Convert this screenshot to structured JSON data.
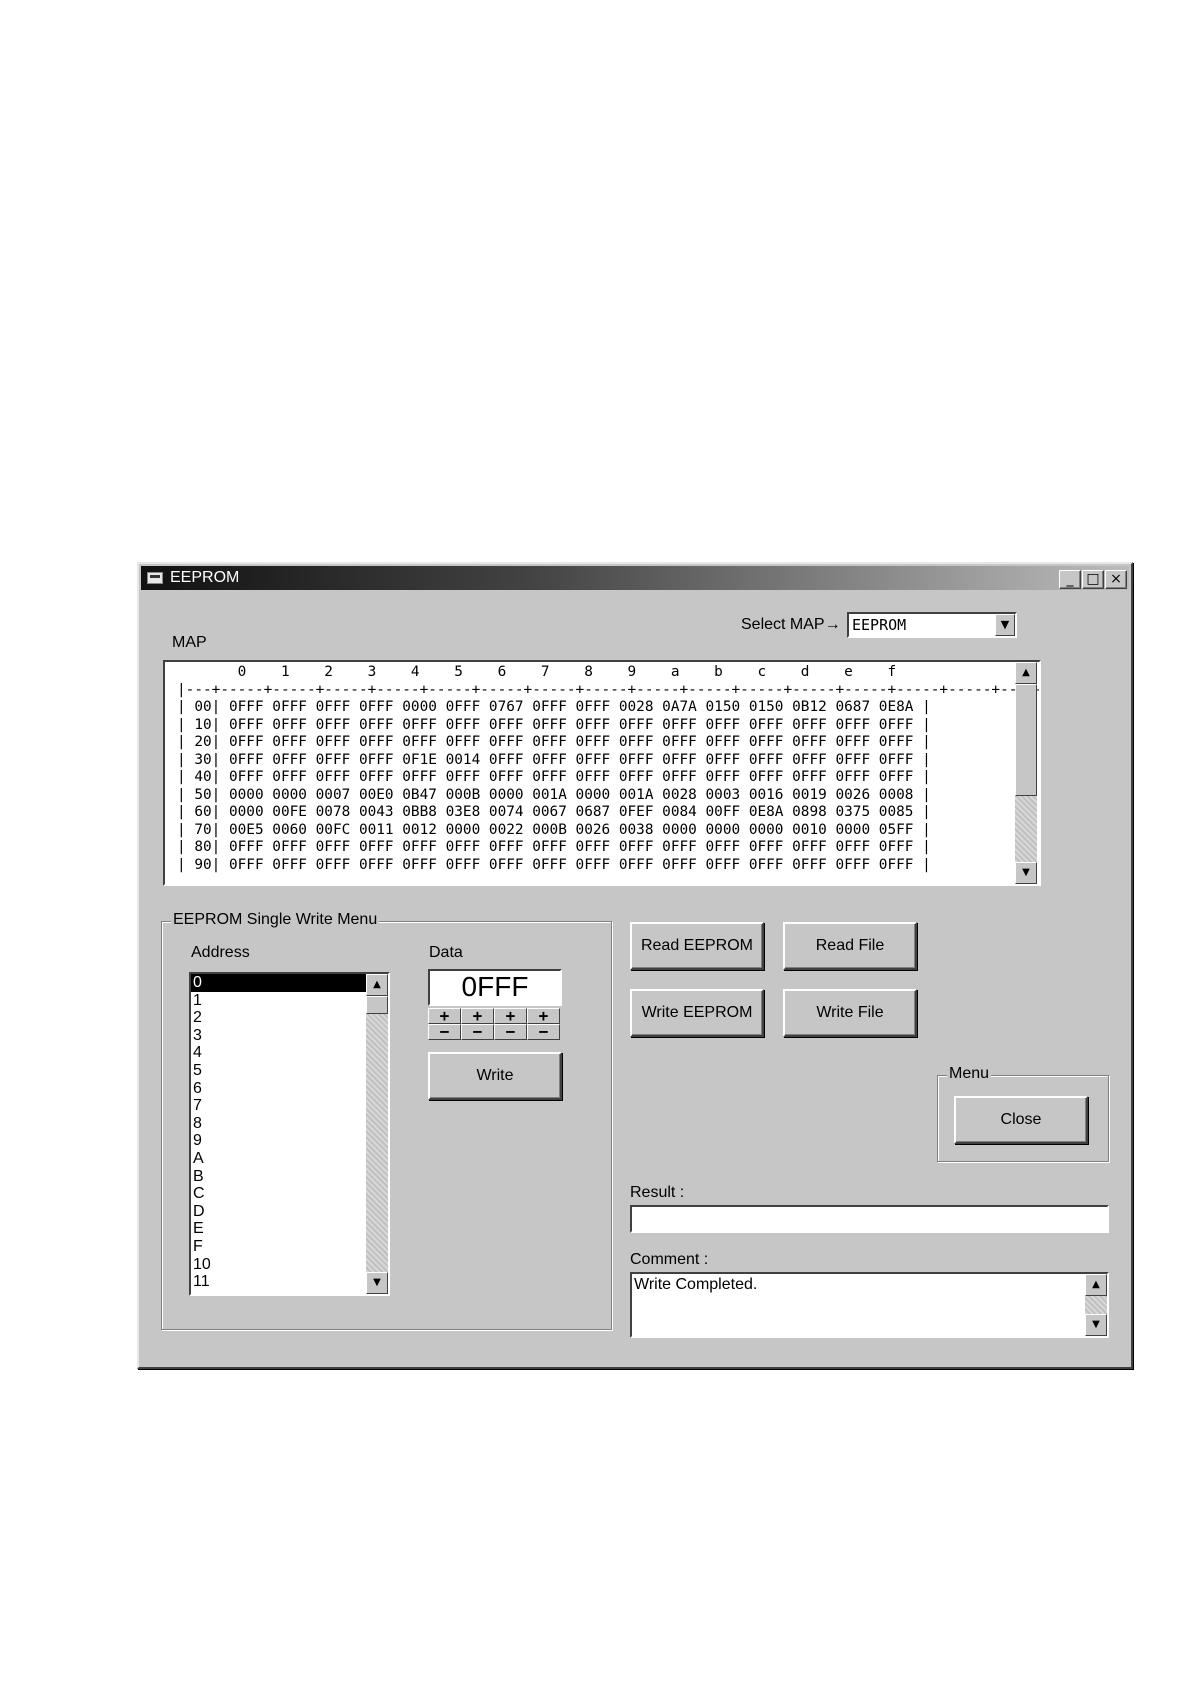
{
  "window": {
    "title": "EEPROM"
  },
  "select_map": {
    "label": "Select MAP→",
    "value": "EEPROM"
  },
  "map": {
    "label": "MAP",
    "column_headers": [
      "0",
      "1",
      "2",
      "3",
      "4",
      "5",
      "6",
      "7",
      "8",
      "9",
      "a",
      "b",
      "c",
      "d",
      "e",
      "f"
    ],
    "rows": [
      {
        "addr": "00",
        "values": [
          "0FFF",
          "0FFF",
          "0FFF",
          "0FFF",
          "0000",
          "0FFF",
          "0767",
          "0FFF",
          "0FFF",
          "0028",
          "0A7A",
          "0150",
          "0150",
          "0B12",
          "0687",
          "0E8A"
        ]
      },
      {
        "addr": "10",
        "values": [
          "0FFF",
          "0FFF",
          "0FFF",
          "0FFF",
          "0FFF",
          "0FFF",
          "0FFF",
          "0FFF",
          "0FFF",
          "0FFF",
          "0FFF",
          "0FFF",
          "0FFF",
          "0FFF",
          "0FFF",
          "0FFF"
        ]
      },
      {
        "addr": "20",
        "values": [
          "0FFF",
          "0FFF",
          "0FFF",
          "0FFF",
          "0FFF",
          "0FFF",
          "0FFF",
          "0FFF",
          "0FFF",
          "0FFF",
          "0FFF",
          "0FFF",
          "0FFF",
          "0FFF",
          "0FFF",
          "0FFF"
        ]
      },
      {
        "addr": "30",
        "values": [
          "0FFF",
          "0FFF",
          "0FFF",
          "0FFF",
          "0F1E",
          "0014",
          "0FFF",
          "0FFF",
          "0FFF",
          "0FFF",
          "0FFF",
          "0FFF",
          "0FFF",
          "0FFF",
          "0FFF",
          "0FFF"
        ]
      },
      {
        "addr": "40",
        "values": [
          "0FFF",
          "0FFF",
          "0FFF",
          "0FFF",
          "0FFF",
          "0FFF",
          "0FFF",
          "0FFF",
          "0FFF",
          "0FFF",
          "0FFF",
          "0FFF",
          "0FFF",
          "0FFF",
          "0FFF",
          "0FFF"
        ]
      },
      {
        "addr": "50",
        "values": [
          "0000",
          "0000",
          "0007",
          "00E0",
          "0B47",
          "000B",
          "0000",
          "001A",
          "0000",
          "001A",
          "0028",
          "0003",
          "0016",
          "0019",
          "0026",
          "0008"
        ]
      },
      {
        "addr": "60",
        "values": [
          "0000",
          "00FE",
          "0078",
          "0043",
          "0BB8",
          "03E8",
          "0074",
          "0067",
          "0687",
          "0FEF",
          "0084",
          "00FF",
          "0E8A",
          "0898",
          "0375",
          "0085"
        ]
      },
      {
        "addr": "70",
        "values": [
          "00E5",
          "0060",
          "00FC",
          "0011",
          "0012",
          "0000",
          "0022",
          "000B",
          "0026",
          "0038",
          "0000",
          "0000",
          "0000",
          "0010",
          "0000",
          "05FF"
        ]
      },
      {
        "addr": "80",
        "values": [
          "0FFF",
          "0FFF",
          "0FFF",
          "0FFF",
          "0FFF",
          "0FFF",
          "0FFF",
          "0FFF",
          "0FFF",
          "0FFF",
          "0FFF",
          "0FFF",
          "0FFF",
          "0FFF",
          "0FFF",
          "0FFF"
        ]
      },
      {
        "addr": "90",
        "values": [
          "0FFF",
          "0FFF",
          "0FFF",
          "0FFF",
          "0FFF",
          "0FFF",
          "0FFF",
          "0FFF",
          "0FFF",
          "0FFF",
          "0FFF",
          "0FFF",
          "0FFF",
          "0FFF",
          "0FFF",
          "0FFF"
        ]
      }
    ]
  },
  "single_write": {
    "title": "EEPROM Single Write Menu",
    "address_label": "Address",
    "addresses": [
      "0",
      "1",
      "2",
      "3",
      "4",
      "5",
      "6",
      "7",
      "8",
      "9",
      "A",
      "B",
      "C",
      "D",
      "E",
      "F",
      "10",
      "11"
    ],
    "selected_address": "0",
    "data_label": "Data",
    "data_value": "0FFF",
    "plus": "+",
    "minus": "−",
    "write_label": "Write"
  },
  "actions": {
    "read_eeprom": "Read EEPROM",
    "read_file": "Read File",
    "write_eeprom": "Write EEPROM",
    "write_file": "Write File"
  },
  "menu": {
    "title": "Menu",
    "close_label": "Close"
  },
  "result": {
    "label": "Result :",
    "value": ""
  },
  "comment": {
    "label": "Comment :",
    "value": "Write Completed."
  }
}
